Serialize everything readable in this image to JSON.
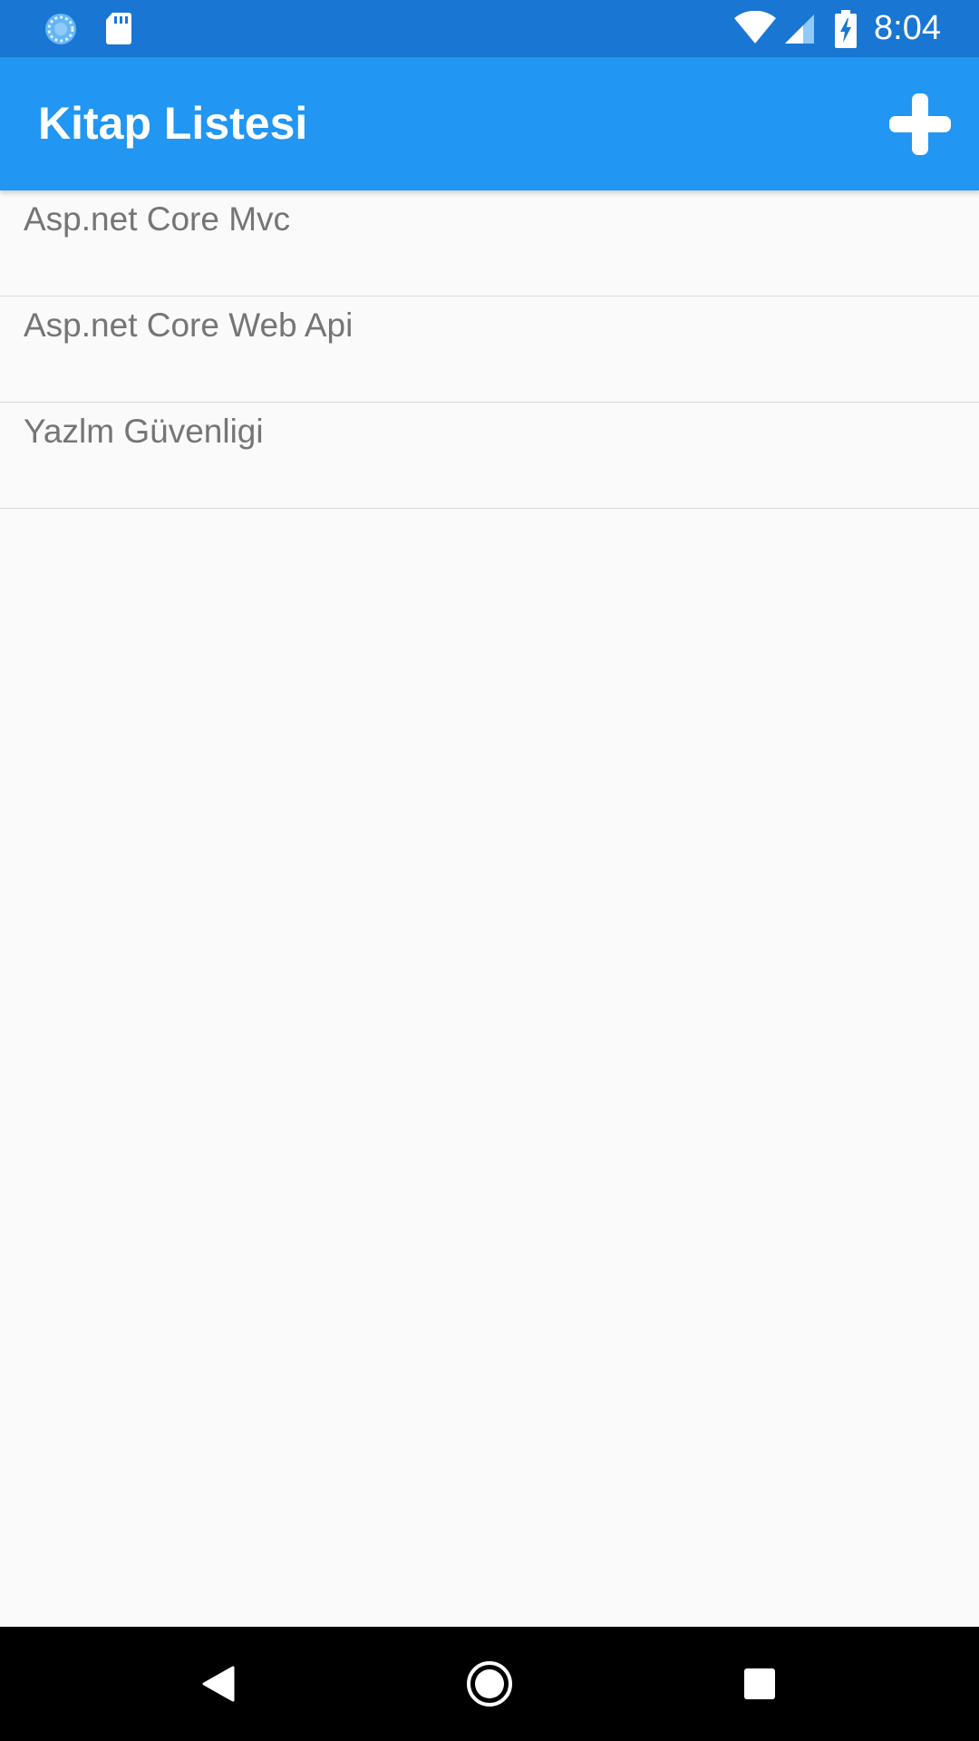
{
  "status_bar": {
    "time": "8:04",
    "left_icons": [
      "sync-icon",
      "sd-card-icon"
    ],
    "right_icons": [
      "wifi-icon",
      "signal-icon",
      "battery-charging-icon"
    ],
    "background": "#1976d2"
  },
  "app_bar": {
    "title": "Kitap Listesi",
    "action_icon": "add-icon",
    "background": "#2196f3"
  },
  "books": [
    {
      "label": "Asp.net Core Mvc"
    },
    {
      "label": "Asp.net Core Web Api"
    },
    {
      "label": "Yazlm Güvenligi"
    }
  ],
  "nav_bar": {
    "icons": [
      "back-icon",
      "home-icon",
      "recents-icon"
    ]
  }
}
